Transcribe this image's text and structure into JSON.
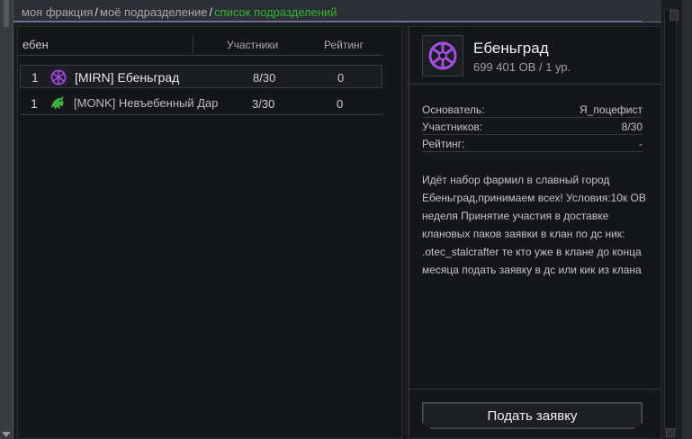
{
  "breadcrumb": {
    "items": [
      "моя фракция",
      "моё подразделение",
      "список подразделений"
    ],
    "separator": "/"
  },
  "list": {
    "search_value": "ебен",
    "columns": {
      "members": "Участники",
      "rating": "Рейтинг"
    },
    "rows": [
      {
        "rank": "1",
        "name": "[MIRN] Ебеньград",
        "members": "8/30",
        "rating": "0",
        "emblem": "purple-rune-icon"
      },
      {
        "rank": "1",
        "name": "[MONK] Невъебенный Дар",
        "members": "3/30",
        "rating": "0",
        "emblem": "green-dragon-icon"
      }
    ]
  },
  "detail": {
    "title": "Ебеньград",
    "subtitle": "699 401 OB / 1 ур.",
    "info": [
      {
        "label": "Основатель:",
        "value": "Я_поцефист"
      },
      {
        "label": "Участников:",
        "value": "8/30"
      },
      {
        "label": "Рейтинг:",
        "value": "-"
      }
    ],
    "description": "Идёт набор фармил в славный город Ебеньград,принимаем всех! Условия:10к OB неделя Принятие участия в доставке клановых паков заявки в клан по дс ник: .otec_stalcrafter те кто уже в клане до конца месяца подать заявку в дс или кик из клана",
    "apply_label": "Подать заявку"
  },
  "colors": {
    "active_crumb": "#2fb52f",
    "accent_border": "#6b6f9a",
    "emblem_purple": "#8e3fc4",
    "emblem_green": "#3fae3f"
  }
}
